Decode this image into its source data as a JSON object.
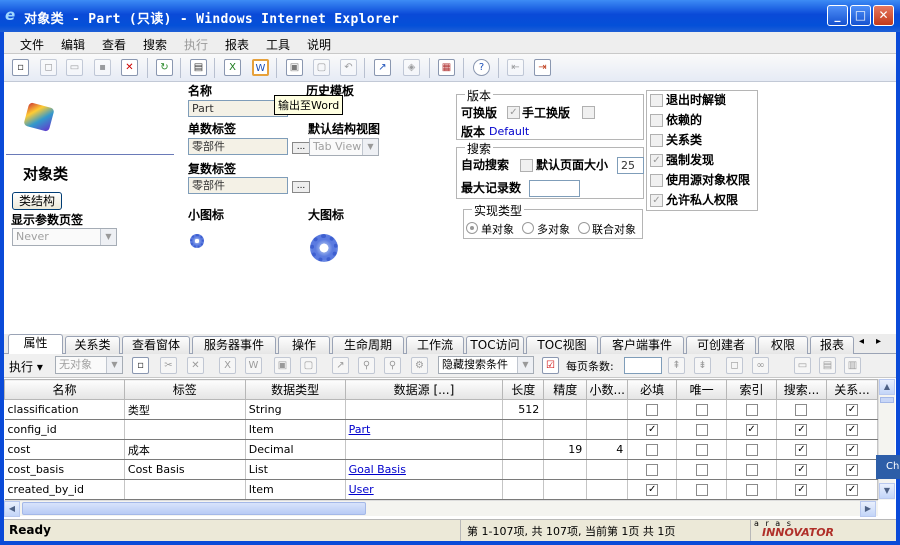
{
  "window": {
    "title": "对象类 - Part (只读) - Windows Internet Explorer",
    "min": "_",
    "max": "□",
    "close": "✕"
  },
  "menu": [
    "文件",
    "编辑",
    "查看",
    "搜索",
    "执行",
    "报表",
    "工具",
    "说明"
  ],
  "menu_disabled": [
    "执行"
  ],
  "toolbar": {
    "tooltip": "输出至Word"
  },
  "form": {
    "title": "对象类",
    "class_structure_button": "类结构",
    "show_param_page_label": "显示参数页签",
    "show_param_page_value": "Never",
    "name_label": "名称",
    "name_value": "Part",
    "history_template_label": "历史模板",
    "singular_label_label": "单数标签",
    "singular_label_value": "零部件",
    "default_structure_view_label": "默认结构视图",
    "default_structure_view_value": "Tab View",
    "plural_label_label": "复数标签",
    "plural_label_value": "零部件",
    "small_icon_label": "小图标",
    "large_icon_label": "大图标",
    "dots": "...",
    "version_group": {
      "title": "版本",
      "versionable_label": "可换版",
      "versionable_checked": true,
      "manual_version_label": "手工换版",
      "manual_version_checked": false,
      "version_label": "版本",
      "version_link": "Default"
    },
    "search_group": {
      "title": "搜索",
      "auto_search_label": "自动搜索",
      "auto_search_checked": false,
      "default_page_size_label": "默认页面大小",
      "default_page_size_value": "25",
      "max_records_label": "最大记录数",
      "max_records_value": ""
    },
    "impl_group": {
      "title": "实现类型",
      "options": [
        "单对象",
        "多对象",
        "联合对象"
      ],
      "selected": "单对象"
    },
    "flags": [
      {
        "label": "退出时解锁",
        "checked": false
      },
      {
        "label": "依赖的",
        "checked": false
      },
      {
        "label": "关系类",
        "checked": false
      },
      {
        "label": "强制发现",
        "checked": true
      },
      {
        "label": "使用源对象权限",
        "checked": false
      },
      {
        "label": "允许私人权限",
        "checked": true
      }
    ]
  },
  "tabs": [
    "属性",
    "关系类",
    "查看窗体",
    "服务器事件",
    "操作",
    "生命周期",
    "工作流",
    "TOC访问",
    "TOC视图",
    "客户端事件",
    "可创建者",
    "权限",
    "报表"
  ],
  "active_tab": "属性",
  "tab_scroll": {
    "left": "◂",
    "right": "▸"
  },
  "grid_toolbar": {
    "execute": "执行 ▾",
    "no_object": "无对象",
    "hidden_search": "隐藏搜索条件",
    "page_size_label": "每页条数:"
  },
  "grid": {
    "columns": [
      "名称",
      "标签",
      "数据类型",
      "数据源 [...]",
      "长度",
      "精度",
      "小数...",
      "必填",
      "唯一",
      "索引",
      "搜索...",
      "关系..."
    ],
    "rows": [
      {
        "name": "classification",
        "label": "类型",
        "type": "String",
        "source": "",
        "length": "512",
        "precision": "",
        "scale": "",
        "required": false,
        "unique": false,
        "indexed": false,
        "search": false,
        "rel": true
      },
      {
        "name": "config_id",
        "label": "",
        "type": "Item",
        "source": "Part",
        "length": "",
        "precision": "",
        "scale": "",
        "required": true,
        "unique": false,
        "indexed": true,
        "search": true,
        "rel": true
      },
      {
        "name": "cost",
        "label": "成本",
        "type": "Decimal",
        "source": "",
        "length": "",
        "precision": "19",
        "scale": "4",
        "required": false,
        "unique": false,
        "indexed": false,
        "search": true,
        "rel": true
      },
      {
        "name": "cost_basis",
        "label": "Cost Basis",
        "type": "List",
        "source": "Goal Basis",
        "length": "",
        "precision": "",
        "scale": "",
        "required": false,
        "unique": false,
        "indexed": false,
        "search": true,
        "rel": true
      },
      {
        "name": "created_by_id",
        "label": "",
        "type": "Item",
        "source": "User",
        "length": "",
        "precision": "",
        "scale": "",
        "required": true,
        "unique": false,
        "indexed": false,
        "search": true,
        "rel": true
      }
    ]
  },
  "status": {
    "left": "Ready",
    "paging": "第 1-107项, 共 107项, 当前第 1页 共 1页",
    "brand": "INNOVATOR",
    "brand_top": "a r a s"
  },
  "side_tab": "Ch"
}
